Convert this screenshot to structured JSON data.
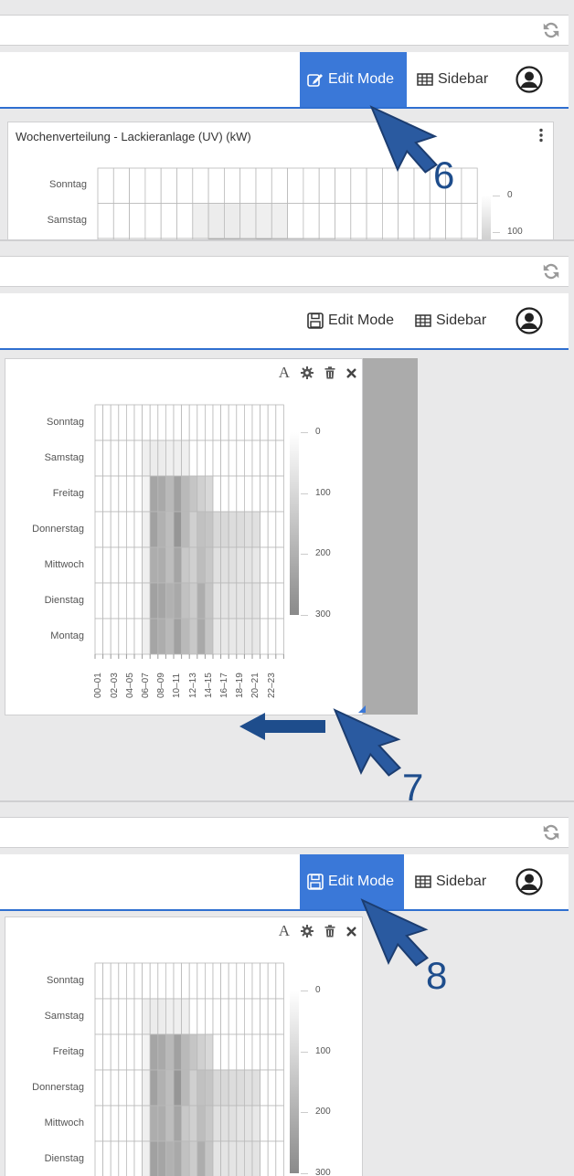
{
  "nav": {
    "edit_mode_label": "Edit Mode",
    "sidebar_label": "Sidebar"
  },
  "widget": {
    "title": "Wochenverteilung - Lackieranlage (UV) (kW)",
    "tool_text": "A"
  },
  "callouts": [
    "6",
    "7",
    "8"
  ],
  "chart_data": {
    "type": "heatmap",
    "title": "Wochenverteilung - Lackieranlage (UV) (kW)",
    "y_categories": [
      "Sonntag",
      "Samstag",
      "Freitag",
      "Donnerstag",
      "Mittwoch",
      "Dienstag",
      "Montag"
    ],
    "x_tick_labels": [
      "00–01",
      "02–03",
      "04–05",
      "06–07",
      "08–09",
      "10–11",
      "12–13",
      "14–15",
      "16–17",
      "18–19",
      "20–21",
      "22–23"
    ],
    "hours": 24,
    "color_scale": {
      "min": 0,
      "max": 300,
      "ticks": [
        0,
        100,
        200,
        300
      ],
      "low_color": "#ffffff",
      "high_color": "#8a8a8a"
    },
    "values": [
      [
        0,
        0,
        0,
        0,
        0,
        0,
        0,
        0,
        0,
        0,
        0,
        0,
        0,
        0,
        0,
        0,
        0,
        0,
        0,
        0,
        0,
        0,
        0,
        0
      ],
      [
        0,
        0,
        0,
        0,
        0,
        0,
        40,
        50,
        50,
        40,
        40,
        40,
        0,
        0,
        0,
        0,
        0,
        0,
        0,
        0,
        0,
        0,
        0,
        0
      ],
      [
        0,
        0,
        0,
        0,
        0,
        0,
        30,
        230,
        220,
        180,
        240,
        180,
        150,
        120,
        100,
        0,
        0,
        0,
        0,
        0,
        0,
        0,
        0,
        0
      ],
      [
        0,
        0,
        0,
        0,
        0,
        0,
        40,
        240,
        200,
        170,
        270,
        180,
        120,
        160,
        150,
        100,
        100,
        90,
        90,
        80,
        80,
        0,
        0,
        0
      ],
      [
        0,
        0,
        0,
        0,
        0,
        0,
        40,
        210,
        210,
        170,
        230,
        140,
        120,
        170,
        140,
        80,
        80,
        80,
        70,
        70,
        60,
        0,
        0,
        0
      ],
      [
        0,
        0,
        0,
        0,
        0,
        0,
        40,
        240,
        230,
        200,
        220,
        160,
        130,
        210,
        150,
        70,
        70,
        70,
        70,
        70,
        70,
        0,
        0,
        0
      ],
      [
        0,
        0,
        0,
        0,
        0,
        0,
        40,
        230,
        210,
        180,
        240,
        180,
        140,
        220,
        150,
        60,
        60,
        60,
        60,
        60,
        60,
        0,
        0,
        0
      ]
    ]
  }
}
